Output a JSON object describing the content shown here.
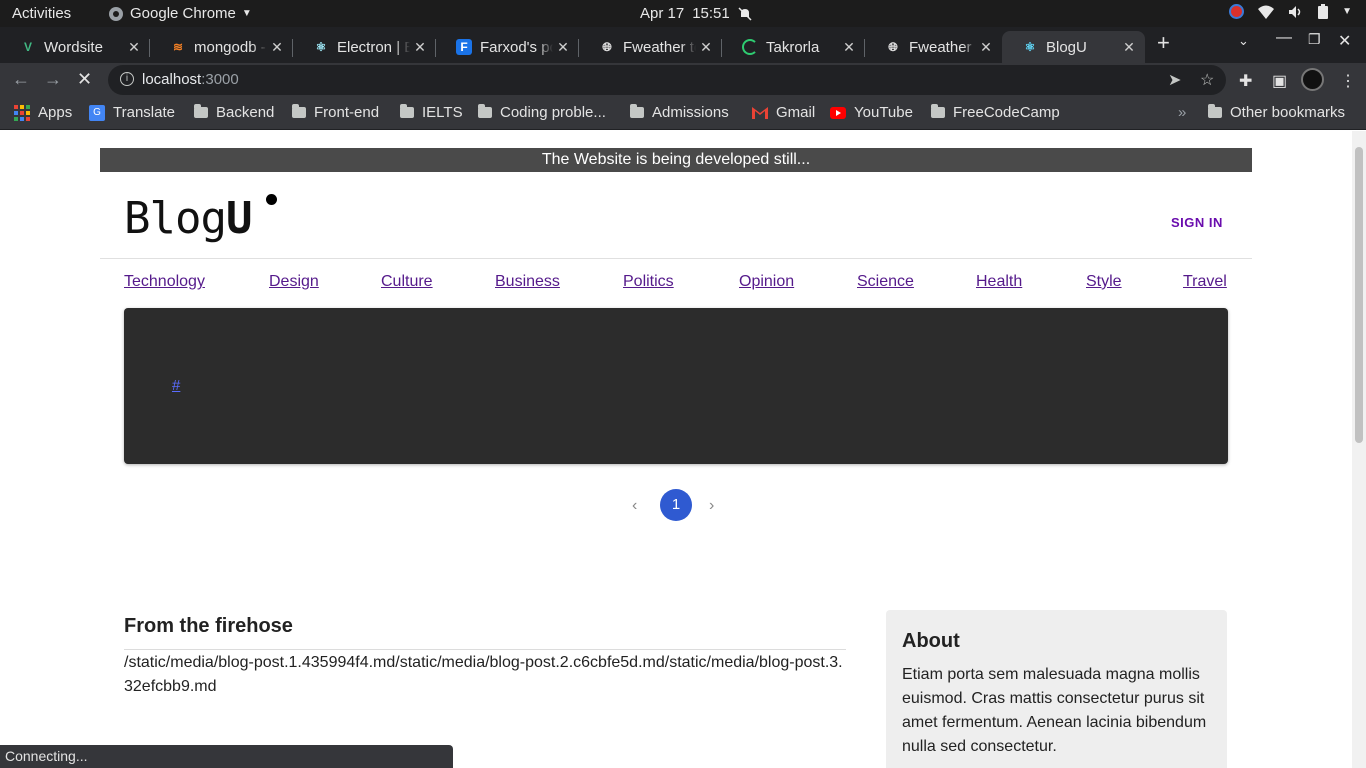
{
  "os": {
    "activities": "Activities",
    "app_name": "Google Chrome",
    "date": "Apr 17",
    "time": "15:51"
  },
  "tabs": [
    {
      "label": "Wordsite",
      "icon": "vue-icon",
      "active": false
    },
    {
      "label": "mongodb - ",
      "icon": "stackoverflow-icon",
      "active": false
    },
    {
      "label": "Electron | B",
      "icon": "electron-icon",
      "active": false
    },
    {
      "label": "Farxod's po",
      "icon": "f-icon",
      "active": false
    },
    {
      "label": "Fweather to",
      "icon": "globe-icon",
      "active": false
    },
    {
      "label": "Takrorla",
      "icon": "loading-icon",
      "active": false
    },
    {
      "label": "Fweather to",
      "icon": "globe-icon",
      "active": false
    },
    {
      "label": "BlogU",
      "icon": "react-icon",
      "active": true
    }
  ],
  "omnibox": {
    "host": "localhost",
    "port": ":3000"
  },
  "bookmarks": [
    {
      "label": "Apps",
      "icon": "apps-grid-icon"
    },
    {
      "label": "Translate",
      "icon": "translate-icon"
    },
    {
      "label": "Backend",
      "icon": "folder-icon"
    },
    {
      "label": "Front-end",
      "icon": "folder-icon"
    },
    {
      "label": "IELTS",
      "icon": "folder-icon"
    },
    {
      "label": "Coding proble...",
      "icon": "folder-icon"
    },
    {
      "label": "Admissions",
      "icon": "folder-icon"
    },
    {
      "label": "Gmail",
      "icon": "gmail-icon"
    },
    {
      "label": "YouTube",
      "icon": "youtube-icon"
    },
    {
      "label": "FreeCodeCamp",
      "icon": "folder-icon"
    }
  ],
  "bookmarks_more": "»",
  "other_bookmarks": "Other bookmarks",
  "page": {
    "banner": "The Website is being developed still...",
    "logo_text": "Blog",
    "logo_bold": "U",
    "sign_in": "SIGN IN",
    "categories": [
      "Technology",
      "Design",
      "Culture",
      "Business",
      "Politics",
      "Opinion",
      "Science",
      "Health",
      "Style",
      "Travel"
    ],
    "hero_link": "#",
    "pager_current": "1",
    "firehose_title": "From the firehose",
    "firehose_text": "/static/media/blog-post.1.435994f4.md/static/media/blog-post.2.c6cbfe5d.md/static/media/blog-post.3.32efcbb9.md",
    "about_title": "About",
    "about_text": "Etiam porta sem malesuada magna mollis euismod. Cras mattis consectetur purus sit amet fermentum. Aenean lacinia bibendum nulla sed consectetur."
  },
  "status_bar": "Connecting...",
  "colors": {
    "accent": "#2f5ad1",
    "link": "#551a8b",
    "signin": "#6a0dad",
    "hero_bg": "#2c2c2c"
  }
}
